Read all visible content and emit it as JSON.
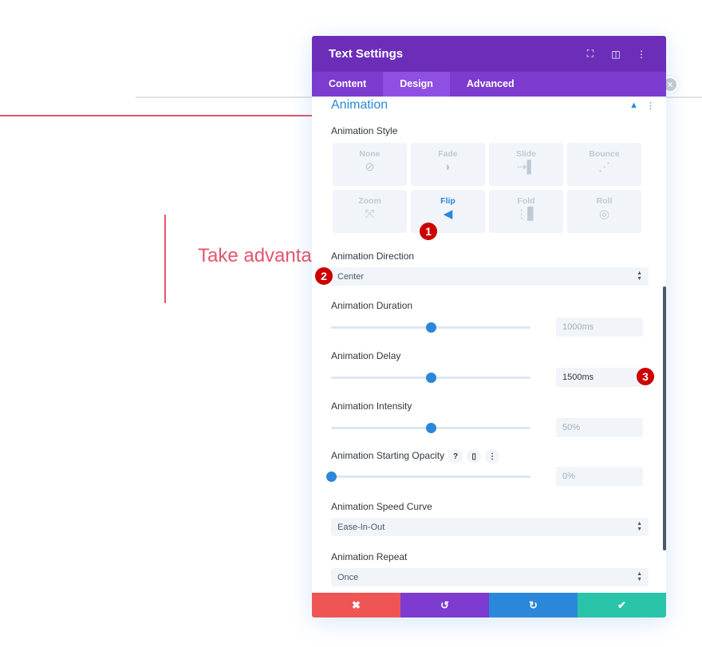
{
  "page": {
    "headline_partial": "Take advantag",
    "close_icon": "close-circle-icon"
  },
  "modal": {
    "title": "Text Settings",
    "header_icons": [
      "focus-icon",
      "split-view-icon",
      "more-vertical-icon"
    ],
    "tabs": [
      {
        "label": "Content",
        "active": false
      },
      {
        "label": "Design",
        "active": true
      },
      {
        "label": "Advanced",
        "active": false
      }
    ],
    "section": {
      "title": "Animation",
      "collapse_icon": "chevron-up-icon",
      "menu_icon": "more-vertical-icon"
    },
    "style": {
      "label": "Animation Style",
      "options": [
        {
          "label": "None",
          "icon": "none-icon",
          "glyph": "⊘",
          "active": false
        },
        {
          "label": "Fade",
          "icon": "fade-icon",
          "glyph": "◗",
          "active": false
        },
        {
          "label": "Slide",
          "icon": "slide-icon",
          "glyph": "⇢▌",
          "active": false
        },
        {
          "label": "Bounce",
          "icon": "bounce-icon",
          "glyph": "⋰",
          "active": false
        },
        {
          "label": "Zoom",
          "icon": "zoom-icon",
          "glyph": "⤧",
          "active": false
        },
        {
          "label": "Flip",
          "icon": "flip-icon",
          "glyph": "◀",
          "active": true
        },
        {
          "label": "Fold",
          "icon": "fold-icon",
          "glyph": "⋮▋",
          "active": false
        },
        {
          "label": "Roll",
          "icon": "roll-icon",
          "glyph": "◎",
          "active": false
        }
      ]
    },
    "direction": {
      "label": "Animation Direction",
      "value": "Center"
    },
    "duration": {
      "label": "Animation Duration",
      "value": "1000ms",
      "slider_percent": 50
    },
    "delay": {
      "label": "Animation Delay",
      "value": "1500ms",
      "slider_percent": 50
    },
    "intensity": {
      "label": "Animation Intensity",
      "value": "50%",
      "slider_percent": 50
    },
    "opacity": {
      "label": "Animation Starting Opacity",
      "value": "0%",
      "slider_percent": 0,
      "icons": [
        "help-icon",
        "mobile-icon",
        "more-vertical-icon"
      ]
    },
    "speed_curve": {
      "label": "Animation Speed Curve",
      "value": "Ease-In-Out"
    },
    "repeat": {
      "label": "Animation Repeat",
      "value": "Once"
    },
    "footer": {
      "cancel": "✖",
      "undo": "↺",
      "redo": "↻",
      "save": "✔"
    },
    "colors": {
      "header": "#6c2eb9",
      "tabs": "#7d3bcf",
      "accent": "#2b87da",
      "cancel": "#ef5555",
      "undo": "#7d3bcf",
      "redo": "#2b87da",
      "save": "#29c4a9"
    }
  },
  "badges": [
    "1",
    "2",
    "3"
  ]
}
